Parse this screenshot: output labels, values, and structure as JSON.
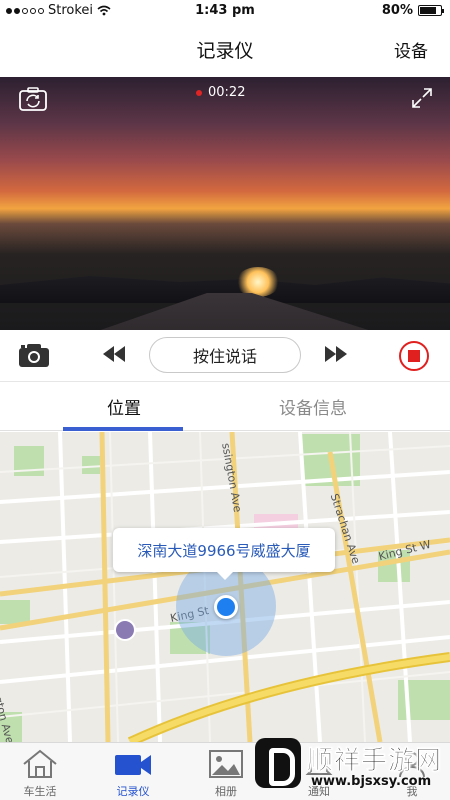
{
  "status_bar": {
    "carrier": "Strokei",
    "time": "1:43 pm",
    "battery": "80%",
    "battery_level": 0.8
  },
  "nav": {
    "title": "记录仪",
    "right_action": "设备"
  },
  "video": {
    "recording_time": "00:22",
    "rec_color": "#e02424"
  },
  "controls": {
    "talk_label": "按住说话",
    "stop_color": "#e0201e"
  },
  "tabs": [
    {
      "label": "位置",
      "active": true
    },
    {
      "label": "设备信息",
      "active": false
    }
  ],
  "map": {
    "callout": "深南大道9966号威盛大厦",
    "streets": [
      "ssington Ave",
      "Strachan Ave",
      "King St W",
      "King St",
      "ngton Ave"
    ],
    "pin_color": "#1d7ff0"
  },
  "bottom_nav": [
    {
      "label": "车生活",
      "icon": "home-icon",
      "active": false
    },
    {
      "label": "记录仪",
      "icon": "video-camera-icon",
      "active": true
    },
    {
      "label": "相册",
      "icon": "image-icon",
      "active": false
    },
    {
      "label": "通知",
      "icon": "bell-icon",
      "active": false
    },
    {
      "label": "我",
      "icon": "user-icon",
      "active": false
    }
  ],
  "watermark": {
    "title": "顺祥手游网",
    "url": "www.bjsxsy.com"
  },
  "accent_color": "#2553d0"
}
